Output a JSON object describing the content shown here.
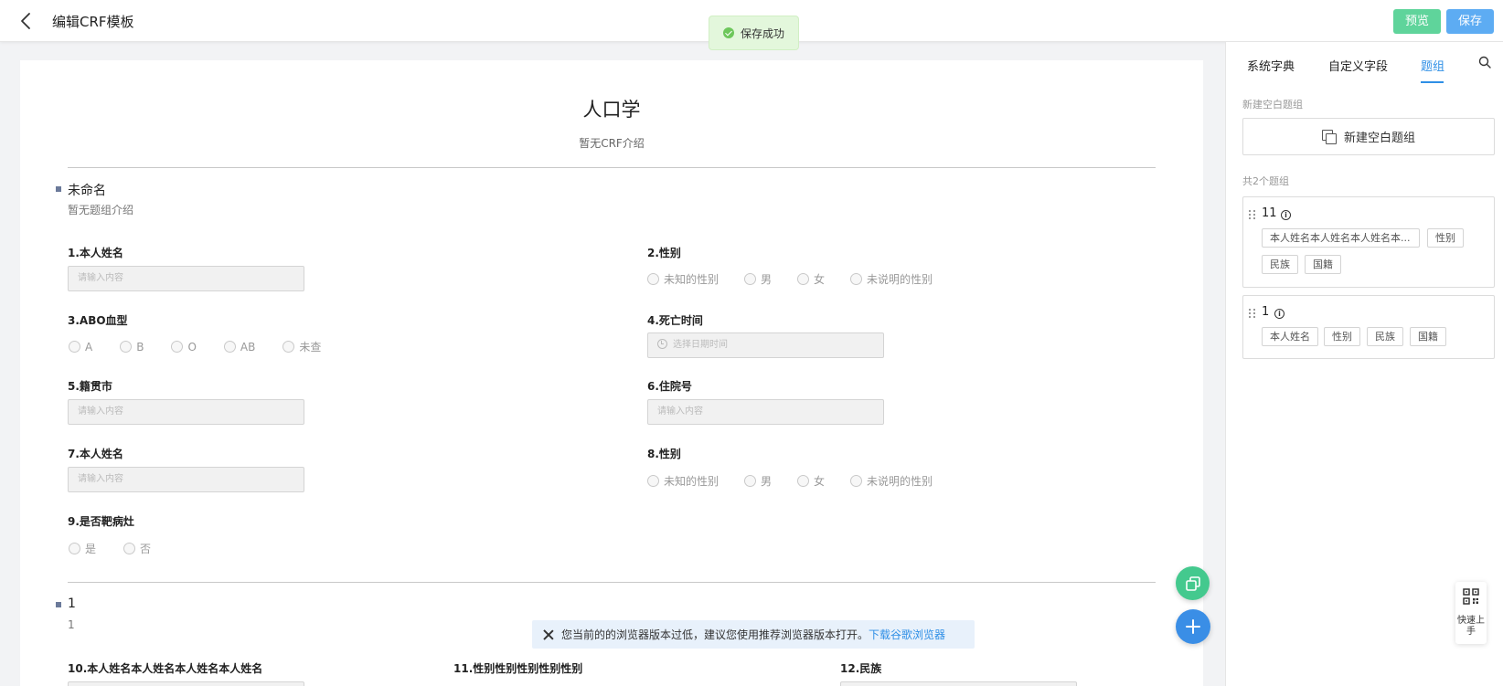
{
  "header": {
    "title": "编辑CRF模板",
    "preview_label": "预览",
    "save_label": "保存",
    "toast": "保存成功"
  },
  "crf": {
    "title": "人口学",
    "intro": "暂无CRF介绍",
    "groups": [
      {
        "name": "未命名",
        "intro": "暂无题组介绍",
        "questions": [
          {
            "label": "1.本人姓名",
            "placeholder": "请输入内容"
          },
          {
            "label": "2.性别",
            "options": [
              "未知的性别",
              "男",
              "女",
              "未说明的性别"
            ]
          },
          {
            "label": "3.ABO血型",
            "options": [
              "A",
              "B",
              "O",
              "AB",
              "未查"
            ]
          },
          {
            "label": "4.死亡时间",
            "placeholder": "选择日期时间"
          },
          {
            "label": "5.籍贯市",
            "placeholder": "请输入内容"
          },
          {
            "label": "6.住院号",
            "placeholder": "请输入内容"
          },
          {
            "label": "7.本人姓名",
            "placeholder": "请输入内容"
          },
          {
            "label": "8.性别",
            "options": [
              "未知的性别",
              "男",
              "女",
              "未说明的性别"
            ]
          },
          {
            "label": "9.是否靶病灶",
            "options": [
              "是",
              "否"
            ]
          }
        ]
      },
      {
        "name": "1",
        "intro": "1",
        "questions": [
          {
            "label": "10.本人姓名本人姓名本人姓名本人姓名"
          },
          {
            "label": "11.性别性别性别性别性别"
          },
          {
            "label": "12.民族"
          }
        ]
      }
    ]
  },
  "browser_notice": {
    "text": "您当前的的浏览器版本过低，建议您使用推荐浏览器版本打开。",
    "link": "下载谷歌浏览器"
  },
  "panel": {
    "tabs": [
      "系统字典",
      "自定义字段",
      "题组"
    ],
    "active_tab": "题组",
    "new_group_label": "新建空白题组",
    "new_group_button": "新建空白题组",
    "count_label": "共2个题组",
    "groups": [
      {
        "name": "11",
        "fields": [
          "本人姓名本人姓名本人姓名本...",
          "性别",
          "民族",
          "国籍"
        ]
      },
      {
        "name": "1",
        "fields": [
          "本人姓名",
          "性别",
          "民族",
          "国籍"
        ]
      }
    ]
  },
  "quick_start": "快速上手",
  "icons": {
    "back": "back-arrow-icon",
    "toast": "check-circle-icon",
    "search": "search-icon",
    "copy": "copy-icon",
    "add": "plus-icon",
    "close": "close-icon",
    "qr": "qr-code-icon"
  },
  "colors": {
    "primary": "#2f8fe6",
    "preview_green": "#5fd49b",
    "save_blue": "#5dacf3",
    "fab_green": "#44c98e",
    "fab_blue": "#3a8ee6"
  }
}
